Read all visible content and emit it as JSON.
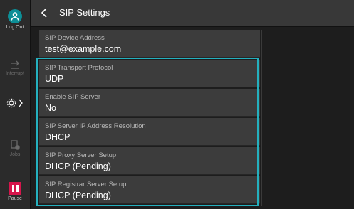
{
  "header": {
    "title": "SIP Settings"
  },
  "rail": {
    "logout_label": "Log Out",
    "interrupt_label": "Interrupt",
    "jobs_label": "Jobs",
    "pause_label": "Pause"
  },
  "settings": [
    {
      "label": "SIP Device Address",
      "value": "test@example.com"
    },
    {
      "label": "SIP Transport Protocol",
      "value": "UDP"
    },
    {
      "label": "Enable SIP Server",
      "value": "No"
    },
    {
      "label": "SIP Server IP Address Resolution",
      "value": "DHCP"
    },
    {
      "label": "SIP Proxy Server Setup",
      "value": "DHCP (Pending)"
    },
    {
      "label": "SIP Registrar Server Setup",
      "value": "DHCP (Pending)"
    }
  ],
  "colors": {
    "accent": "#24b0be",
    "logout": "#0d8f97",
    "pause": "#d6164c"
  }
}
